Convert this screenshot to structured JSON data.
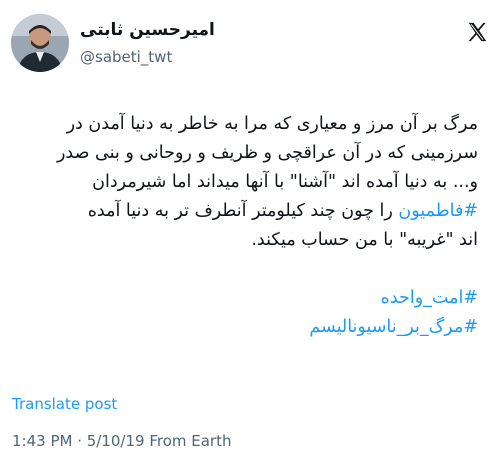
{
  "author": {
    "name": "امیرحسین ثابتی",
    "handle": "@sabeti_twt"
  },
  "tweet": {
    "lines": [
      "مرگ بر آن مرز و معیاری که مرا به خاطر به دنیا آمدن در",
      "سرزمینی که در آن عراقچی و ظریف و روحانی و بنی صدر",
      "و... به دنیا آمده اند \"آشنا\" با آنها میداند اما شیرمردان",
      "را چون چند کیلومتر آنطرف تر به دنیا آمده",
      "اند \"غریبه\" با من حساب میکند."
    ],
    "hashtag_inline": "#فاطمیون",
    "hashtags": [
      "#امت_واحده",
      "#مرگ_بر_ناسیونالیسم"
    ]
  },
  "actions": {
    "translate_label": "Translate post"
  },
  "meta": {
    "timestamp": "1:43 PM · 5/10/19 From Earth"
  },
  "icons": {
    "logo": "x-logo-icon",
    "avatar": "avatar"
  },
  "colors": {
    "link": "#1d9bf0",
    "secondary": "#536471",
    "text": "#0f1419"
  }
}
